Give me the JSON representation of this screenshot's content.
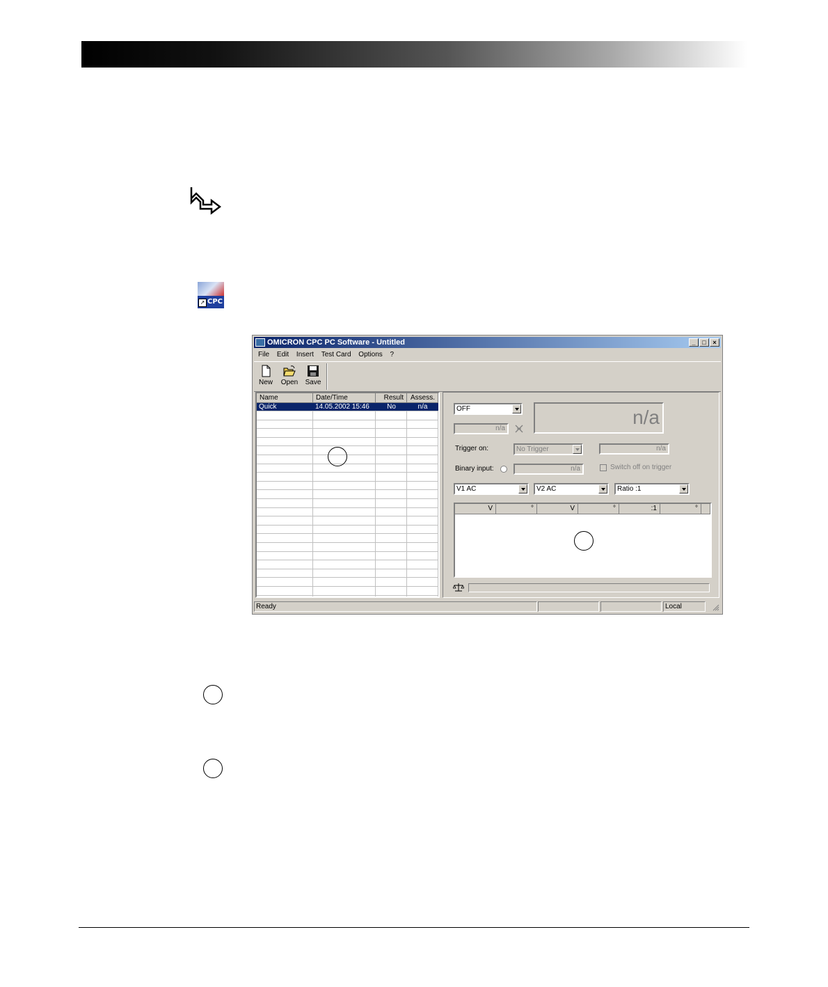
{
  "window": {
    "title": "OMICRON CPC PC Software - Untitled",
    "controls": [
      "_",
      "□",
      "×"
    ]
  },
  "menu": [
    "File",
    "Edit",
    "Insert",
    "Test Card",
    "Options",
    "?"
  ],
  "toolbar": [
    {
      "label": "New",
      "icon": "new-document-icon"
    },
    {
      "label": "Open",
      "icon": "open-folder-icon"
    },
    {
      "label": "Save",
      "icon": "save-disk-icon"
    }
  ],
  "test_list": {
    "columns": [
      "Name",
      "Date/Time",
      "Result",
      "Assess."
    ],
    "rows": [
      {
        "name": "Quick",
        "datetime": "14.05.2002 15:46",
        "result": "No",
        "assess": "n/a"
      }
    ]
  },
  "quick_panel": {
    "mode_select": "OFF",
    "big_display": "n/a",
    "small_field": "n/a",
    "trigger_label": "Trigger on:",
    "trigger_select": "No Trigger",
    "trigger_field": "n/a",
    "binary_label": "Binary input:",
    "binary_field": "n/a",
    "switch_off_label": "Switch off on trigger",
    "meas1": "V1 AC",
    "meas2": "V2 AC",
    "meas3": "Ratio :1",
    "result_headers": [
      "V",
      "°",
      "V",
      "°",
      ":1",
      "°"
    ]
  },
  "statusbar": {
    "text": "Ready",
    "mode": "Local"
  },
  "colors": {
    "selection": "#0a246a",
    "window_face": "#d4d0c8"
  }
}
